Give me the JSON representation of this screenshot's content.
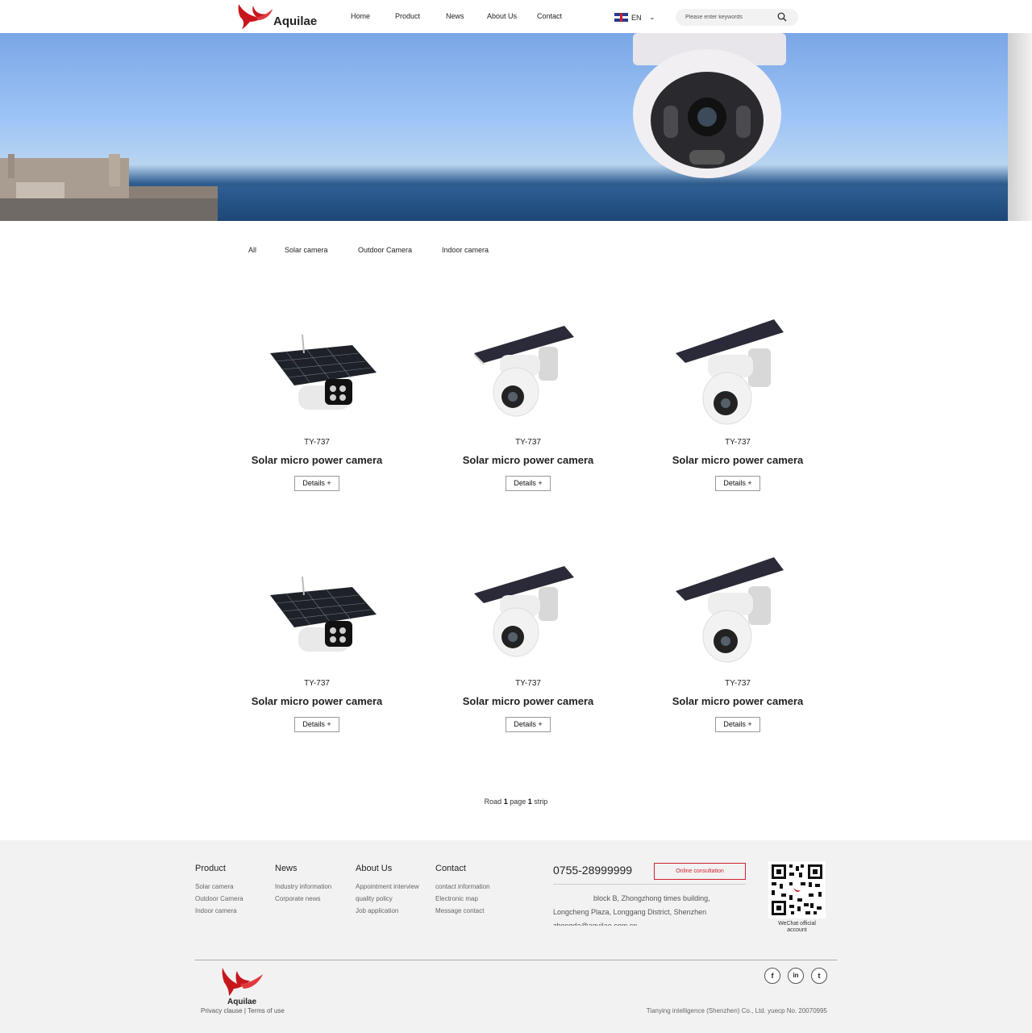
{
  "header": {
    "brand": "Aquilae",
    "nav": [
      "Home",
      "Product",
      "News",
      "About Us",
      "Contact"
    ],
    "language": "EN",
    "search_placeholder": "Please enter keywords"
  },
  "filters": [
    "All",
    "Solar camera",
    "Outdoor Camera",
    "Indoor camera"
  ],
  "products": [
    {
      "model": "TY-737",
      "name": "Solar micro power camera",
      "button": "Details +",
      "image": "solar-bullet-camera"
    },
    {
      "model": "TY-737",
      "name": "Solar micro power camera",
      "button": "Details +",
      "image": "solar-dome-camera"
    },
    {
      "model": "TY-737",
      "name": "Solar micro power camera",
      "button": "Details +",
      "image": "solar-dome-camera"
    },
    {
      "model": "TY-737",
      "name": "Solar micro power camera",
      "button": "Details +",
      "image": "solar-bullet-camera"
    },
    {
      "model": "TY-737",
      "name": "Solar micro power camera",
      "button": "Details +",
      "image": "solar-dome-camera"
    },
    {
      "model": "TY-737",
      "name": "Solar micro power camera",
      "button": "Details +",
      "image": "solar-dome-camera"
    }
  ],
  "pagination": {
    "prefix": "Road",
    "page": "1",
    "middle": "page",
    "strip": "1",
    "suffix": "strip"
  },
  "footer": {
    "columns": [
      {
        "title": "Product",
        "links": [
          "Solar camera",
          "Outdoor Camera",
          "Indoor camera"
        ]
      },
      {
        "title": "News",
        "links": [
          "Industry information",
          "Corporate news"
        ]
      },
      {
        "title": "About Us",
        "links": [
          "Appointment interview",
          "quality policy",
          "Job application"
        ]
      },
      {
        "title": "Contact",
        "links": [
          "contact information",
          "Electronic map",
          "Message contact"
        ]
      }
    ],
    "phone": "0755-28999999",
    "consult_button": "Online consultation",
    "address_lines": [
      "block B, Zhongzhong times building,",
      "Longcheng Plaza, Longgang District, Shenzhen",
      "zhongda@aquilae.com.cn"
    ],
    "qr_caption": "WeChat official account",
    "brand": "Aquilae",
    "privacy": "Privacy clause",
    "separator": "|",
    "terms": "Terms of use",
    "copyright": "Tianying intelligence (Shenzhen) Co., Ltd. yuecp No. 20070995",
    "social": [
      "f",
      "in",
      "t"
    ],
    "social_icons": [
      "facebook-icon",
      "linkedin-icon",
      "twitter-icon"
    ]
  },
  "colors": {
    "accent_red": "#d0202e",
    "footer_bg": "#f2f2f2"
  }
}
